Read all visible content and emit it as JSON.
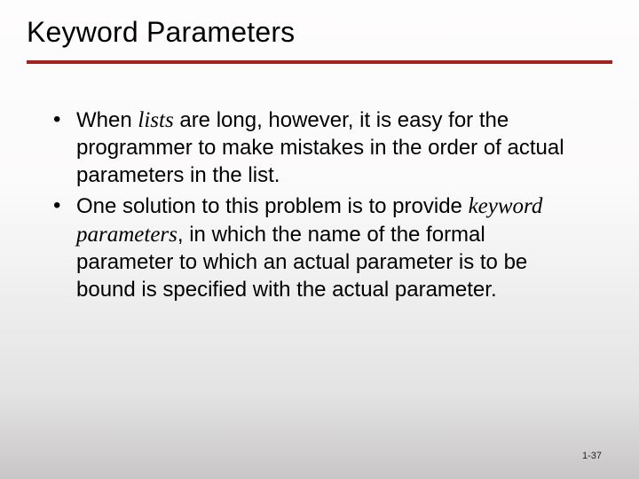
{
  "slide": {
    "title": "Keyword Parameters",
    "bullets": [
      {
        "pre": "When ",
        "term": "lists",
        "post": " are long, however, it is easy for the programmer to make mistakes in the order of actual parameters in the list."
      },
      {
        "pre": "One solution to this problem is to provide ",
        "term": "keyword parameters",
        "post": ", in which the name of the formal parameter to which an actual parameter is to be bound is specified with the actual parameter."
      }
    ],
    "page_number": "1-37"
  }
}
